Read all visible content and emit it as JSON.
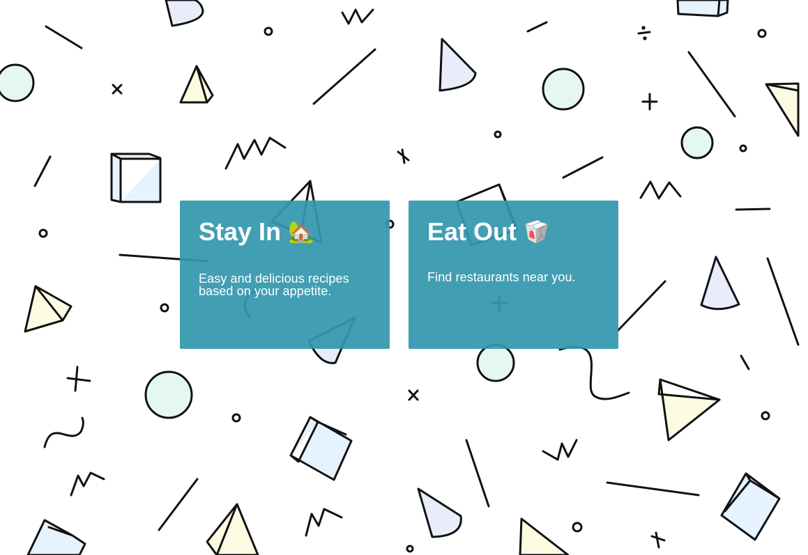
{
  "choices": [
    {
      "title": "Stay In",
      "emoji": "🏡",
      "description": "Easy and delicious recipes based on your appetite."
    },
    {
      "title": "Eat Out",
      "emoji": "🥡",
      "description": "Find restaurants near you."
    }
  ],
  "colors": {
    "card_background": "#3497ad",
    "card_text": "#ffffff",
    "pattern_stroke": "#111111",
    "mint_fill": "#e4f7f1",
    "lavender_fill": "#e8ecfb",
    "cream_fill": "#fefbe3",
    "ice_fill": "#e6f3fe"
  }
}
